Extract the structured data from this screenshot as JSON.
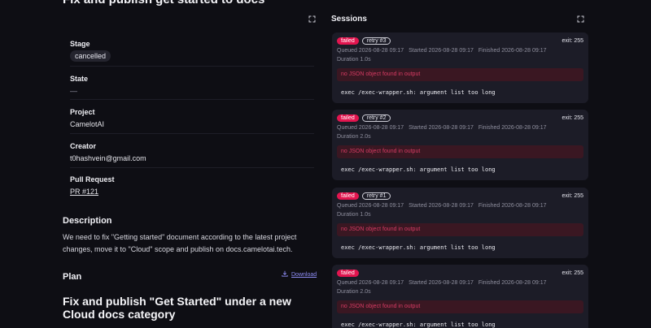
{
  "page_title": "Fix and publish get started to docs",
  "details": {
    "stage": {
      "label": "Stage",
      "value": "cancelled"
    },
    "state": {
      "label": "State",
      "value": "—"
    },
    "project": {
      "label": "Project",
      "value": "CamelotAI"
    },
    "creator": {
      "label": "Creator",
      "value": "t0hashvein@gmail.com"
    },
    "pull_request": {
      "label": "Pull Request",
      "value": "PR #121"
    }
  },
  "description": {
    "heading": "Description",
    "text": "We need to fix \"Getting started\" document according to the latest project changes, move it to \"Cloud\" scope and publish on docs.camelotai.tech."
  },
  "plan": {
    "heading": "Plan",
    "download_label": "Download",
    "title": "Fix and publish \"Get Started\" under a new Cloud docs category"
  },
  "sessions": {
    "heading": "Sessions",
    "items": [
      {
        "status": "failed",
        "retry": "retry #3",
        "exit": "exit: 255",
        "queued": "Queued 2026-08-28 09:17",
        "started": "Started 2026-08-28 09:17",
        "finished": "Finished 2026-08-28 09:17",
        "duration": "Duration 1.0s",
        "error": "no JSON object found in output",
        "output": "exec /exec-wrapper.sh: argument list too long"
      },
      {
        "status": "failed",
        "retry": "retry #2",
        "exit": "exit: 255",
        "queued": "Queued 2026-08-28 09:17",
        "started": "Started 2026-08-28 09:17",
        "finished": "Finished 2026-08-28 09:17",
        "duration": "Duration 2.0s",
        "error": "no JSON object found in output",
        "output": "exec /exec-wrapper.sh: argument list too long"
      },
      {
        "status": "failed",
        "retry": "retry #1",
        "exit": "exit: 255",
        "queued": "Queued 2026-08-28 09:17",
        "started": "Started 2026-08-28 09:17",
        "finished": "Finished 2026-08-28 09:17",
        "duration": "Duration 1.0s",
        "error": "no JSON object found in output",
        "output": "exec /exec-wrapper.sh: argument list too long"
      },
      {
        "status": "failed",
        "retry": "",
        "exit": "exit: 255",
        "queued": "Queued 2026-08-28 09:17",
        "started": "Started 2026-08-28 09:17",
        "finished": "Finished 2026-08-28 09:17",
        "duration": "Duration 2.0s",
        "error": "no JSON object found in output",
        "output": "exec /exec-wrapper.sh: argument list too long"
      }
    ]
  },
  "colors": {
    "background": "#0e0e14",
    "card": "#1c1c27",
    "failed": "#e2154f",
    "error_bg": "#3a1722",
    "accent_link": "#8d8cf3"
  },
  "icons": {
    "expand": "expand-icon",
    "download": "download-icon"
  }
}
